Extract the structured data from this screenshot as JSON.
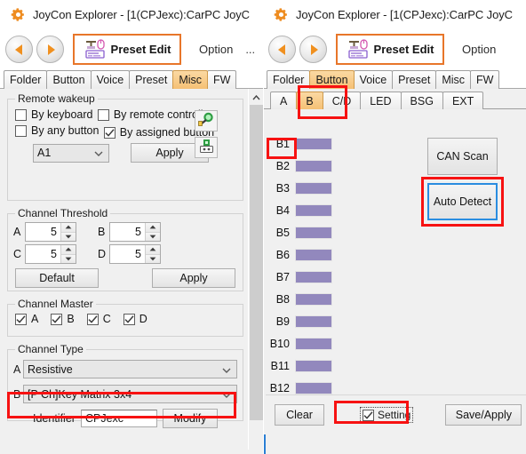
{
  "window": {
    "title": "JoyCon Explorer - [1(CPJexc):CarPC JoyC",
    "gear_icon": "gear-icon"
  },
  "toolbar": {
    "back_icon": "back-arrow-icon",
    "forward_icon": "forward-arrow-icon",
    "preset_edit_label": "Preset Edit",
    "preset_edit_icon": "keyboard-mouse-icon",
    "option_label": "Option",
    "overflow_label": "..."
  },
  "main_tabs": {
    "items": [
      "Folder",
      "Button",
      "Voice",
      "Preset",
      "Misc",
      "FW"
    ],
    "left_active": "Misc",
    "right_active": "Button"
  },
  "left_panel": {
    "remote_wakeup": {
      "legend": "Remote wakeup",
      "options": [
        {
          "label": "By keyboard",
          "checked": false
        },
        {
          "label": "By remote controller",
          "checked": false
        },
        {
          "label": "By any button",
          "checked": false
        },
        {
          "label": "By assigned button",
          "checked": true
        }
      ],
      "assigned_value": "A1",
      "apply_label": "Apply",
      "icons": [
        "plug-connector-icon",
        "power-socket-icon"
      ]
    },
    "channel_threshold": {
      "legend": "Channel Threshold",
      "fields": [
        {
          "label": "A",
          "value": "5"
        },
        {
          "label": "B",
          "value": "5"
        },
        {
          "label": "C",
          "value": "5"
        },
        {
          "label": "D",
          "value": "5"
        }
      ],
      "default_label": "Default",
      "apply_label": "Apply"
    },
    "channel_master": {
      "legend": "Channel Master",
      "options": [
        {
          "label": "A",
          "checked": true
        },
        {
          "label": "B",
          "checked": true
        },
        {
          "label": "C",
          "checked": true
        },
        {
          "label": "D",
          "checked": true
        }
      ]
    },
    "channel_type": {
      "legend": "Channel Type",
      "rows": [
        {
          "label": "A",
          "value": "Resistive"
        },
        {
          "label": "B",
          "value": "[P Ch]Key Matrix 3x4"
        }
      ],
      "identifier_label": "Identifier",
      "identifier_value": "CPJexc",
      "modify_label": "Modify"
    },
    "scrollbar": {
      "up_icon": "chevron-up-icon"
    }
  },
  "right_panel": {
    "sub_tabs": {
      "items": [
        "A",
        "B",
        "C/D",
        "LED",
        "BSG",
        "EXT"
      ],
      "active": "B"
    },
    "buttons_list": [
      {
        "label": "B1",
        "color": "#9288bd"
      },
      {
        "label": "B2",
        "color": "#9288bd"
      },
      {
        "label": "B3",
        "color": "#9288bd"
      },
      {
        "label": "B4",
        "color": "#9288bd"
      },
      {
        "label": "B5",
        "color": "#9288bd"
      },
      {
        "label": "B6",
        "color": "#9288bd"
      },
      {
        "label": "B7",
        "color": "#9288bd"
      },
      {
        "label": "B8",
        "color": "#9288bd"
      },
      {
        "label": "B9",
        "color": "#9288bd"
      },
      {
        "label": "B10",
        "color": "#9288bd"
      },
      {
        "label": "B11",
        "color": "#9288bd"
      },
      {
        "label": "B12",
        "color": "#9288bd"
      }
    ],
    "can_scan_label": "CAN Scan",
    "auto_detect_label": "Auto Detect",
    "bottom": {
      "clear_label": "Clear",
      "setting_label": "Setting",
      "setting_checked": true,
      "save_apply_label": "Save/Apply"
    }
  },
  "annotations": {
    "accent_red": "#f71212",
    "accent_orange": "#e8762a",
    "focus_blue": "#2a8de0",
    "swatch_purple": "#9288bd",
    "tab_active": "#f5c074"
  }
}
